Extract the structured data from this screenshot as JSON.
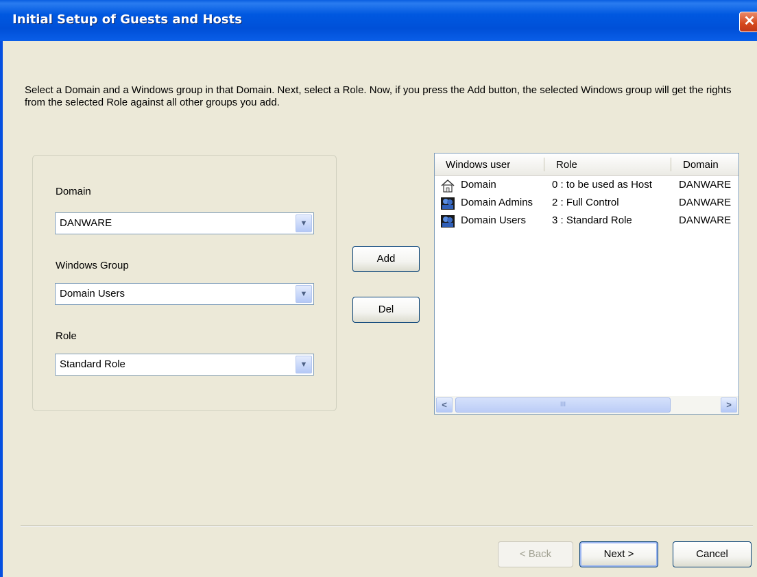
{
  "window": {
    "title": "Initial Setup of Guests and Hosts",
    "close_label": "✕"
  },
  "instructions": "Select a Domain and a Windows group in that Domain. Next, select a Role. Now, if you press the Add button, the selected Windows group will get the rights from the selected Role against all other groups you add.",
  "form": {
    "domain": {
      "label": "Domain",
      "value": "DANWARE"
    },
    "windows_group": {
      "label": "Windows Group",
      "value": "Domain Users"
    },
    "role": {
      "label": "Role",
      "value": "Standard Role"
    },
    "dropdown_glyph": "▼"
  },
  "buttons": {
    "add": "Add",
    "del": "Del",
    "back": "< Back",
    "next": "Next >",
    "cancel": "Cancel"
  },
  "list": {
    "columns": [
      "Windows user",
      "Role",
      "Domain"
    ],
    "rows": [
      {
        "icon": "domain-home-icon",
        "user": "Domain",
        "role": "0 : to be used as Host",
        "domain": "DANWARE"
      },
      {
        "icon": "user-group-icon",
        "user": "Domain Admins",
        "role": "2 : Full Control",
        "domain": "DANWARE"
      },
      {
        "icon": "user-group-icon",
        "user": "Domain Users",
        "role": "3 : Standard Role",
        "domain": "DANWARE"
      }
    ],
    "scroll_left": "<",
    "scroll_right": ">",
    "thumb_grip": "III"
  }
}
